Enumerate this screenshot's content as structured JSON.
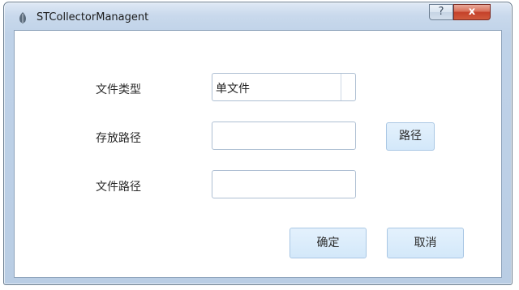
{
  "window": {
    "title": "STCollectorManagent",
    "help_glyph": "?",
    "close_glyph": "x"
  },
  "form": {
    "file_type_label": "文件类型",
    "file_type_value": "单文件",
    "save_path_label": "存放路径",
    "save_path_value": "",
    "browse_button_label": "路径",
    "file_path_label": "文件路径",
    "file_path_value": ""
  },
  "buttons": {
    "ok_label": "确定",
    "cancel_label": "取消"
  },
  "colors": {
    "button_fill": "#d9ecfb",
    "title_bar": "#c9d9ec",
    "close_button": "#c4412a"
  },
  "icons": {
    "app": "app-leaf-icon",
    "help": "help-icon",
    "close": "close-icon",
    "dropdown": "chevron-down-icon"
  }
}
